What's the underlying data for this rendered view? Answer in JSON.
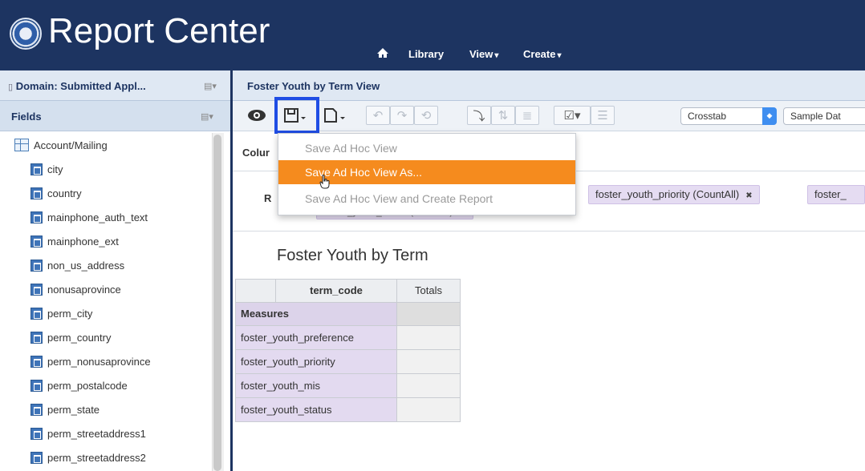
{
  "header": {
    "app_title": "Report Center",
    "nav": [
      {
        "label": "Library"
      },
      {
        "label": "View"
      },
      {
        "label": "Create"
      }
    ],
    "bg_color": "#1d3461"
  },
  "left_panel": {
    "domain_label": "Domain: Submitted Appl...",
    "fields_label": "Fields",
    "tree": {
      "group_label": "Account/Mailing",
      "items": [
        "city",
        "country",
        "mainphone_auth_text",
        "mainphone_ext",
        "non_us_address",
        "nonusaprovince",
        "perm_city",
        "perm_country",
        "perm_nonusaprovince",
        "perm_postalcode",
        "perm_state",
        "perm_streetaddress1",
        "perm_streetaddress2"
      ]
    }
  },
  "view": {
    "title": "Foster Youth by Term View",
    "toolbar": {
      "view_type_select": "Crosstab",
      "data_select": "Sample Dat"
    },
    "columns_label": "Colur",
    "rows_label": "R",
    "row_chips": [
      {
        "label": "foster_youth_priority (CountAll)"
      },
      {
        "label": "foster_"
      }
    ],
    "row_chip_partial": "foster_youth_status (CountAll)"
  },
  "save_menu": {
    "items": [
      {
        "label": "Save Ad Hoc View",
        "state": "disabled"
      },
      {
        "label": "Save Ad Hoc View As...",
        "state": "hover"
      },
      {
        "label": "Save Ad Hoc View and Create Report",
        "state": "disabled"
      }
    ],
    "hover_color": "#f58b1e",
    "highlight_color": "#1f4de4"
  },
  "report": {
    "title": "Foster Youth by Term",
    "column_header": "term_code",
    "totals_header": "Totals",
    "measures_label": "Measures",
    "rows": [
      "foster_youth_preference",
      "foster_youth_priority",
      "foster_youth_mis",
      "foster_youth_status"
    ]
  }
}
